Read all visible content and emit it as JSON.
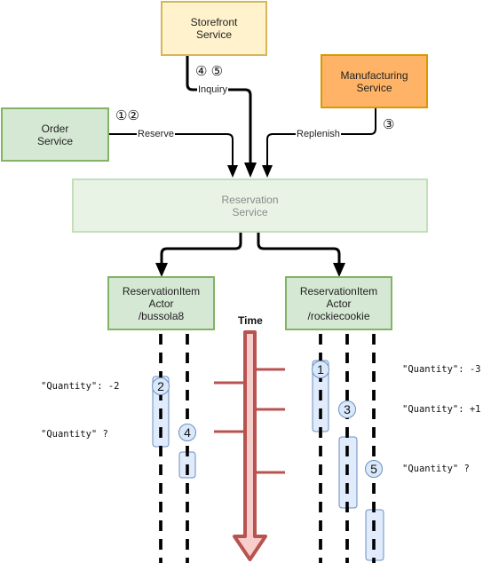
{
  "services": {
    "storefront": {
      "label": "Storefront\nService"
    },
    "manufacturing": {
      "label": "Manufacturing\nService"
    },
    "order": {
      "label": "Order\nService"
    },
    "reservation": {
      "label": "Reservation\nService"
    }
  },
  "actors": [
    {
      "label": "ReservationItem\nActor\n/bussola8"
    },
    {
      "label": "ReservationItem\nActor\n/rockiecookie"
    }
  ],
  "edges": {
    "inquiry": {
      "label": "Inquiry",
      "steps": "④ ⑤"
    },
    "reserve": {
      "label": "Reserve",
      "steps": "①②"
    },
    "replenish": {
      "label": "Replenish",
      "steps": "③"
    }
  },
  "timeline": {
    "label": "Time"
  },
  "step_markers": [
    "1",
    "2",
    "3",
    "4",
    "5"
  ],
  "annotations": {
    "left": [
      "\"Quantity\": -2",
      "\"Quantity\" ?"
    ],
    "right": [
      "\"Quantity\": -3",
      "\"Quantity\": +1",
      "\"Quantity\" ?"
    ]
  },
  "colors": {
    "green_fill": "#d5e8d4",
    "green_stroke": "#82b366",
    "yellow_fill": "#fff2cc",
    "yellow_stroke": "#d6b656",
    "orange_fill": "#ffb366",
    "orange_stroke": "#d79b00",
    "time_fill": "#f8cecc",
    "time_stroke": "#b85450",
    "activation_fill": "#dae8fc",
    "activation_stroke": "#6c8ebf"
  }
}
